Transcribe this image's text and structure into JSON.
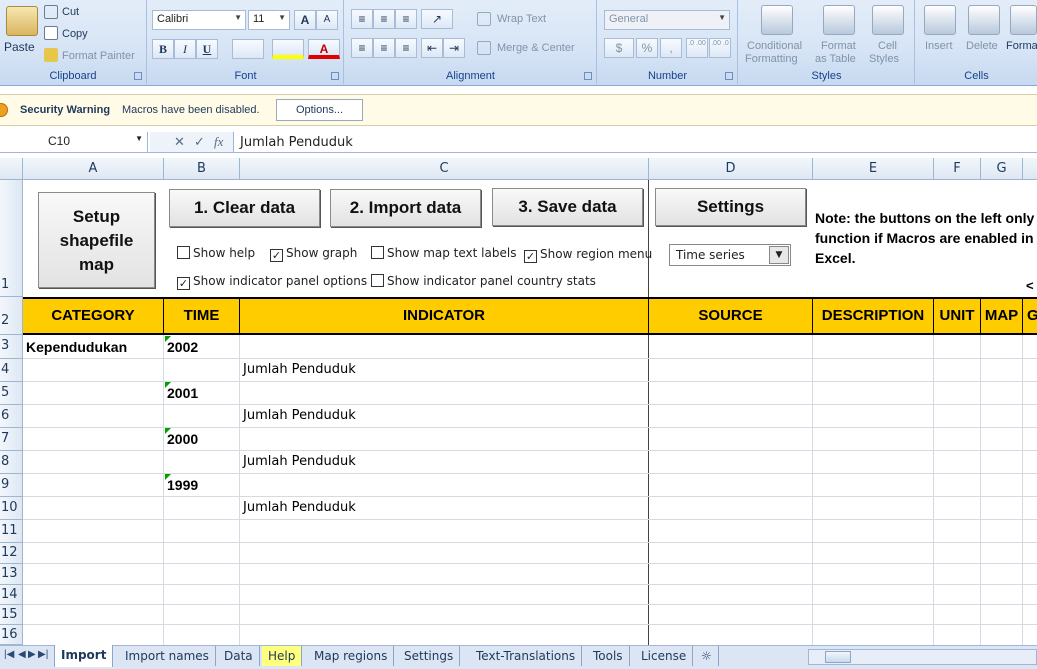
{
  "ribbon": {
    "clipboard": {
      "paste": "Paste",
      "cut": "Cut",
      "copy": "Copy",
      "format_painter": "Format Painter",
      "label": "Clipboard"
    },
    "font": {
      "font_name": "Calibri",
      "font_size": "11",
      "label": "Font",
      "bold": "B",
      "italic": "I",
      "underline": "U",
      "grow": "A",
      "shrink": "A",
      "font_color": "A"
    },
    "alignment": {
      "wrap_text": "Wrap Text",
      "merge_center": "Merge & Center",
      "label": "Alignment"
    },
    "number": {
      "format": "General",
      "percent": "%",
      "comma": ",",
      "inc_dec": ".0 .00",
      "dec_dec": ".00 .0",
      "label": "Number"
    },
    "styles": {
      "conditional_line1": "Conditional",
      "conditional_line2": "Formatting",
      "format_table_line1": "Format",
      "format_table_line2": "as Table",
      "cell_styles_line1": "Cell",
      "cell_styles_line2": "Styles",
      "label": "Styles"
    },
    "cells": {
      "insert": "Insert",
      "delete": "Delete",
      "format": "Forma",
      "label": "Cells"
    }
  },
  "security": {
    "title": "Security Warning",
    "message": "Macros have been disabled.",
    "options": "Options..."
  },
  "formula_bar": {
    "name_box": "C10",
    "fx": "fx",
    "cancel": "✕",
    "enter": "✓",
    "content": "Jumlah Penduduk"
  },
  "columns": [
    "A",
    "B",
    "C",
    "D",
    "E",
    "F",
    "G"
  ],
  "rows": [
    "1",
    "2",
    "3",
    "4",
    "5",
    "6",
    "7",
    "8",
    "9",
    "10",
    "11",
    "12",
    "13",
    "14",
    "15",
    "16"
  ],
  "controls": {
    "setup_line1": "Setup",
    "setup_line2": "shapefile",
    "setup_line3": "map",
    "clear": "1. Clear data",
    "import": "2. Import data",
    "save": "3. Save data",
    "settings": "Settings",
    "show_help": "Show help",
    "show_graph": "Show graph",
    "show_map_labels": "Show map text labels",
    "show_region_menu": "Show region menu",
    "show_indicator_panel": "Show indicator panel options",
    "show_indicator_country": "Show indicator panel country stats",
    "checked": {
      "show_help": false,
      "show_graph": true,
      "show_map_labels": false,
      "show_region_menu": true,
      "show_indicator_panel": true,
      "show_indicator_country": false
    },
    "time_series": "Time series",
    "note": "Note: the buttons on the left only function if Macros are enabled in Excel.",
    "scroll_hint": "<"
  },
  "header_row": {
    "category": "CATEGORY",
    "time": "TIME",
    "indicator": "INDICATOR",
    "source": "SOURCE",
    "description": "DESCRIPTION",
    "unit": "UNIT",
    "map": "MAP",
    "extra": "G"
  },
  "data_rows": [
    {
      "category": "Kependudukan",
      "time": "2002",
      "indicator": ""
    },
    {
      "category": "",
      "time": "",
      "indicator": "Jumlah Penduduk"
    },
    {
      "category": "",
      "time": "2001",
      "indicator": ""
    },
    {
      "category": "",
      "time": "",
      "indicator": "Jumlah Penduduk"
    },
    {
      "category": "",
      "time": "2000",
      "indicator": ""
    },
    {
      "category": "",
      "time": "",
      "indicator": "Jumlah Penduduk"
    },
    {
      "category": "",
      "time": "1999",
      "indicator": ""
    },
    {
      "category": "",
      "time": "",
      "indicator": "Jumlah Penduduk"
    }
  ],
  "sheet_tabs": [
    "Import",
    "Import names",
    "Data",
    "Help",
    "Map regions",
    "Settings",
    "Text-Translations",
    "Tools",
    "License"
  ],
  "colors": {
    "header_yellow": "#ffcc00",
    "ribbon_blue": "#d6e4f5",
    "help_tab": "#ffff80"
  }
}
